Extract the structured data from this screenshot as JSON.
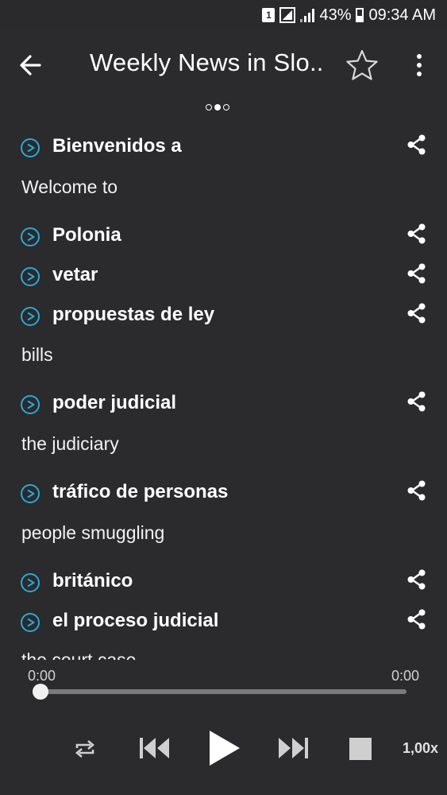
{
  "status_bar": {
    "sim_slot": "1",
    "battery_percent": "43%",
    "time": "09:34 AM"
  },
  "toolbar": {
    "title": "Weekly News in Slo.."
  },
  "pager": {
    "pages": 3,
    "active_index": 1
  },
  "entries": [
    {
      "word": "Bienvenidos a",
      "translation": "Welcome to"
    },
    {
      "word": "Polonia",
      "translation": ""
    },
    {
      "word": "vetar",
      "translation": ""
    },
    {
      "word": "propuestas de ley",
      "translation": "bills"
    },
    {
      "word": "poder judicial",
      "translation": "the judiciary"
    },
    {
      "word": "tráfico de personas",
      "translation": "people smuggling"
    },
    {
      "word": "británico",
      "translation": ""
    },
    {
      "word": "el proceso judicial",
      "translation": "the court case"
    }
  ],
  "player": {
    "elapsed": "0:00",
    "duration": "0:00",
    "progress": 0,
    "speed": "1,00x"
  },
  "colors": {
    "background": "#2b2a2c",
    "accent": "#29a9d8",
    "text": "#ffffff"
  }
}
